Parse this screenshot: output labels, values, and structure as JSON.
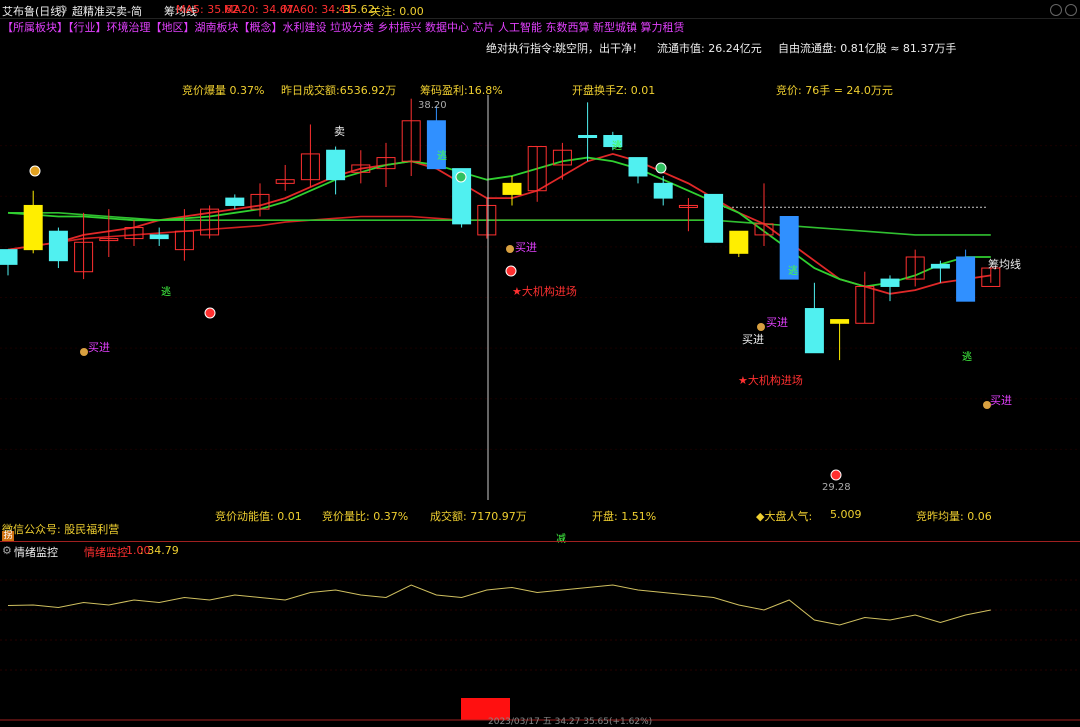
{
  "title_bar": {
    "stock": "艾布鲁(日线)",
    "indicator_name": "超精准买卖-简",
    "sub_indicator": "筹均线",
    "ma5": "MA5: 35.62",
    "ma20": "MA20: 34.67",
    "ma60": "MA60: 34.41",
    "mid": ": 35.62",
    "follow": "关注: 0.00"
  },
  "sectors": "【所属板块】【行业】环境治理【地区】湖南板块【概念】水利建设 垃圾分类 乡村振兴 数据中心 芯片 人工智能 东数西算 新型城镇 算力租赁",
  "info_row1": {
    "exec_label": "绝对执行指令:",
    "exec_value": "跳空阴，出干净！",
    "float_mv": "流通市值: 26.24亿元",
    "free_float": "自由流通盘: 0.81亿股 ≈ 81.37万手"
  },
  "info_row2": {
    "bid_volume": "竞价爆量 0.37%",
    "prev_turnover": "昨日成交额:6536.92万",
    "chip_profit": "筹码盈利:16.8%",
    "open_turnover": "开盘换手Z: 0.01",
    "bid_price": "竞价: 76手 = 24.0万元"
  },
  "info_bottom": {
    "bid_momentum": "竞价动能值: 0.01",
    "bid_ratio": "竞价量比: 0.37%",
    "turnover": "成交额: 7170.97万",
    "open": "开盘: 1.51%",
    "market_mood_label": "◆大盘人气:",
    "market_mood_value": "5.009",
    "bid_avg_vol": "竞昨均量: 0.06"
  },
  "wechat": "微信公众号: 股民福利营",
  "tag_top_left": "拐",
  "reduce_label": "减",
  "chart_labels": {
    "sell": "卖",
    "buy": "买进",
    "escape": "逃",
    "inst_enter": "★大机构进场",
    "chip_line": "筹均线",
    "high_price": "38.20",
    "low_price": "29.28"
  },
  "sub_panel": {
    "title": "情绪监控",
    "name": "情绪监控",
    "v1": "1.00",
    "v2": ": 34.79"
  },
  "bottom_status": "2023/03/17 五 34.27 35.65(+1.62%)",
  "chart_data": {
    "type": "candlestick",
    "candles": [
      {
        "o": 35.4,
        "c": 35.8,
        "h": 35.8,
        "l": 35.1,
        "up": false
      },
      {
        "o": 35.8,
        "c": 37.0,
        "h": 37.4,
        "l": 35.7,
        "up": true,
        "fill": "yellow"
      },
      {
        "o": 35.5,
        "c": 36.3,
        "h": 36.4,
        "l": 35.3,
        "up": false
      },
      {
        "o": 35.2,
        "c": 36.0,
        "h": 36.8,
        "l": 35.0,
        "up": true
      },
      {
        "o": 36.1,
        "c": 36.1,
        "h": 36.9,
        "l": 35.6,
        "up": true
      },
      {
        "o": 36.1,
        "c": 36.4,
        "h": 36.6,
        "l": 35.9,
        "up": true
      },
      {
        "o": 36.1,
        "c": 36.2,
        "h": 36.4,
        "l": 35.9,
        "up": false
      },
      {
        "o": 35.8,
        "c": 36.3,
        "h": 36.9,
        "l": 35.5,
        "up": true
      },
      {
        "o": 36.2,
        "c": 36.9,
        "h": 37.0,
        "l": 36.1,
        "up": true
      },
      {
        "o": 37.2,
        "c": 37.0,
        "h": 37.3,
        "l": 36.9,
        "up": false
      },
      {
        "o": 36.9,
        "c": 37.3,
        "h": 37.6,
        "l": 36.7,
        "up": true
      },
      {
        "o": 37.6,
        "c": 37.7,
        "h": 38.1,
        "l": 37.4,
        "up": true
      },
      {
        "o": 37.7,
        "c": 38.4,
        "h": 39.2,
        "l": 37.5,
        "up": true
      },
      {
        "o": 38.5,
        "c": 37.7,
        "h": 38.6,
        "l": 37.3,
        "up": false
      },
      {
        "o": 37.9,
        "c": 38.1,
        "h": 38.5,
        "l": 37.6,
        "up": true
      },
      {
        "o": 38.0,
        "c": 38.3,
        "h": 38.7,
        "l": 37.5,
        "up": true
      },
      {
        "o": 38.2,
        "c": 39.3,
        "h": 39.9,
        "l": 37.8,
        "up": true
      },
      {
        "o": 39.3,
        "c": 38.0,
        "h": 39.7,
        "l": 38.0,
        "up": false,
        "fill": "blue"
      },
      {
        "o": 38.0,
        "c": 36.5,
        "h": 38.0,
        "l": 36.4,
        "up": false
      },
      {
        "o": 36.2,
        "c": 37.0,
        "h": 37.2,
        "l": 36.1,
        "up": true
      },
      {
        "o": 37.3,
        "c": 37.6,
        "h": 37.8,
        "l": 37.0,
        "up": true,
        "fill": "yellow"
      },
      {
        "o": 37.4,
        "c": 38.6,
        "h": 38.6,
        "l": 37.1,
        "up": true
      },
      {
        "o": 38.1,
        "c": 38.5,
        "h": 38.7,
        "l": 37.7,
        "up": true
      },
      {
        "o": 38.9,
        "c": 38.9,
        "h": 39.8,
        "l": 38.2,
        "up": false
      },
      {
        "o": 38.9,
        "c": 38.6,
        "h": 39.0,
        "l": 38.5,
        "up": false
      },
      {
        "o": 38.3,
        "c": 37.8,
        "h": 38.3,
        "l": 37.6,
        "up": false
      },
      {
        "o": 37.6,
        "c": 37.2,
        "h": 37.8,
        "l": 37.0,
        "up": false
      },
      {
        "o": 37.0,
        "c": 37.0,
        "h": 37.2,
        "l": 36.3,
        "up": true
      },
      {
        "o": 37.3,
        "c": 36.0,
        "h": 37.3,
        "l": 36.0,
        "up": false
      },
      {
        "o": 36.3,
        "c": 35.7,
        "h": 36.3,
        "l": 35.6,
        "up": false,
        "fill": "yellow"
      },
      {
        "o": 36.2,
        "c": 36.5,
        "h": 37.6,
        "l": 35.9,
        "up": true
      },
      {
        "o": 36.7,
        "c": 35.0,
        "h": 36.7,
        "l": 35.0,
        "up": false,
        "fill": "blue"
      },
      {
        "o": 34.2,
        "c": 33.0,
        "h": 34.9,
        "l": 33.0,
        "up": false
      },
      {
        "o": 33.9,
        "c": 33.8,
        "h": 33.9,
        "l": 32.8,
        "up": false,
        "fill": "yellow"
      },
      {
        "o": 33.8,
        "c": 34.8,
        "h": 35.2,
        "l": 33.8,
        "up": true
      },
      {
        "o": 35.0,
        "c": 34.8,
        "h": 35.1,
        "l": 34.4,
        "up": false
      },
      {
        "o": 35.0,
        "c": 35.6,
        "h": 35.8,
        "l": 34.8,
        "up": true
      },
      {
        "o": 35.3,
        "c": 35.4,
        "h": 35.5,
        "l": 34.9,
        "up": false
      },
      {
        "o": 35.6,
        "c": 34.4,
        "h": 35.8,
        "l": 34.4,
        "up": false,
        "fill": "blue"
      },
      {
        "o": 34.8,
        "c": 35.3,
        "h": 35.3,
        "l": 34.9,
        "up": true
      }
    ],
    "ma_red": [
      35.8,
      35.9,
      36.0,
      36.2,
      36.3,
      36.4,
      36.6,
      36.7,
      36.8,
      36.9,
      37.0,
      37.2,
      37.5,
      37.8,
      38.0,
      38.1,
      38.2,
      38.0,
      37.6,
      37.2,
      37.2,
      37.4,
      37.8,
      38.2,
      38.4,
      38.2,
      37.9,
      37.6,
      37.2,
      36.8,
      36.5,
      36.0,
      35.5,
      35.0,
      34.8,
      34.6,
      34.7,
      34.9,
      35.0,
      35.1
    ],
    "ma_green": [
      36.8,
      36.75,
      36.7,
      36.7,
      36.65,
      36.6,
      36.6,
      36.65,
      36.7,
      36.8,
      36.9,
      37.1,
      37.4,
      37.7,
      37.9,
      38.1,
      38.2,
      38.1,
      37.9,
      37.7,
      37.8,
      38.0,
      38.2,
      38.3,
      38.2,
      38.0,
      37.7,
      37.4,
      37.1,
      36.8,
      36.3,
      35.8,
      35.3,
      35.0,
      34.8,
      34.9,
      35.1,
      35.4,
      35.6,
      35.6
    ],
    "ma_chip": 36.95,
    "price_range": [
      29.0,
      40.0
    ],
    "sentiment": [
      34.79,
      34.8,
      34.75,
      34.85,
      34.8,
      34.9,
      34.85,
      34.95,
      34.9,
      35.0,
      34.95,
      34.9,
      35.05,
      35.1,
      35.0,
      34.95,
      35.2,
      35.0,
      34.95,
      35.1,
      35.15,
      35.05,
      35.1,
      35.15,
      35.2,
      35.1,
      35.05,
      35.0,
      34.95,
      34.8,
      34.7,
      34.9,
      34.5,
      34.4,
      34.55,
      34.5,
      34.6,
      34.45,
      34.6,
      34.7
    ]
  }
}
